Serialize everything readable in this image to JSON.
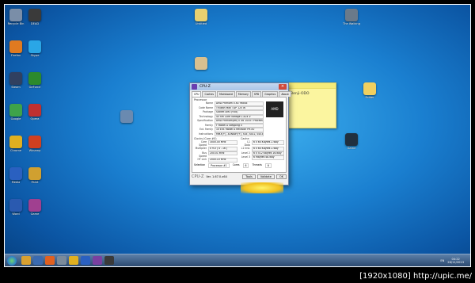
{
  "desktop": {
    "icons": [
      {
        "label": "Recycle Bin",
        "color": "#7a8ea8"
      },
      {
        "label": "DEAD",
        "color": "#3a3a3a"
      },
      {
        "label": "Firefox",
        "color": "#e07a20"
      },
      {
        "label": "Skype",
        "color": "#2aa6e6"
      },
      {
        "label": "Steam",
        "color": "#304060"
      },
      {
        "label": "GeForce",
        "color": "#2c8a2c"
      },
      {
        "label": "Google",
        "color": "#3ea34a"
      },
      {
        "label": "Opera",
        "color": "#c03030"
      },
      {
        "label": "Chrome",
        "color": "#e0b020"
      },
      {
        "label": "Winamp",
        "color": "#d04020"
      },
      {
        "label": "Media",
        "color": "#2a60c0"
      },
      {
        "label": "Paint",
        "color": "#d0a030"
      },
      {
        "label": "Word",
        "color": "#2a5ab0"
      },
      {
        "label": "Game",
        "color": "#a04090"
      }
    ],
    "file_icons": [
      {
        "label": "Untitled",
        "color": "#e8d070"
      },
      {
        "label": "The Walking Dead",
        "color": "#6a7a8a"
      },
      {
        "label": "Folder",
        "color": "#f0d060"
      },
      {
        "label": "Game",
        "color": "#203040"
      }
    ]
  },
  "sticky_note": {
    "text": "Benji-ODO"
  },
  "cpuz": {
    "title": "CPU-Z",
    "tabs": [
      "CPU",
      "Caches",
      "Mainboard",
      "Memory",
      "SPD",
      "Graphics",
      "About"
    ],
    "processor_group": "Processor",
    "rows": [
      {
        "k": "Name",
        "v": "AMD Phenom II X4 965BE"
      },
      {
        "k": "Code Name",
        "v": "Thuban   Max TDP  125 W"
      },
      {
        "k": "Package",
        "v": "Socket AM3 (938)"
      },
      {
        "k": "Technology",
        "v": "45 nm   Core Voltage  1.424 V"
      },
      {
        "k": "Specification",
        "v": "AMD Phenom(tm) II X6 1055T Processor"
      },
      {
        "k": "Family",
        "v": "F    Model  A    Stepping  0"
      },
      {
        "k": "Ext. Family",
        "v": "10   Ext. Model  A   Revision  PH-E0"
      },
      {
        "k": "Instructions",
        "v": "MMX(+), 3DNow!(+), SSE, SSE2, SSE3, SSE4A, x86-64, AMD-V"
      }
    ],
    "clocks_group": "Clocks (Core #0)",
    "cache_group": "Cache",
    "clock_rows": [
      {
        "k": "Core Speed",
        "v": "3000.00 MHz"
      },
      {
        "k": "Multiplier",
        "v": "x 9.0 ( 4 - 16 )"
      },
      {
        "k": "Bus Speed",
        "v": "200.01 MHz"
      },
      {
        "k": "HT Link",
        "v": "2000.10 MHz"
      }
    ],
    "cache_rows": [
      {
        "k": "L1 Data",
        "v": "6 x 64 KBytes  2-way"
      },
      {
        "k": "L1 Inst.",
        "v": "6 x 64 KBytes  2-way"
      },
      {
        "k": "Level 2",
        "v": "6 x 512 KBytes  16-way"
      },
      {
        "k": "Level 3",
        "v": "6 MBytes  48-way"
      }
    ],
    "selection_label": "Selection",
    "selection_value": "Processor #1",
    "cores_label": "Cores",
    "cores_value": "6",
    "threads_label": "Threads",
    "threads_value": "6",
    "brand": "CPU-Z",
    "version": "Ver. 1.67.0.x64",
    "tools_label": "Tools",
    "validate_label": "Validate",
    "ok_label": "OK"
  },
  "taskbar": {
    "apps": [
      {
        "color": "#d8a030"
      },
      {
        "color": "#3a6ab0"
      },
      {
        "color": "#e06020"
      },
      {
        "color": "#7a8a9a"
      },
      {
        "color": "#e0b020"
      },
      {
        "color": "#2a60c0"
      },
      {
        "color": "#7a40a0"
      },
      {
        "color": "#3a3a3a"
      }
    ],
    "language": "EN",
    "time": "04:22",
    "date": "26/11/2013"
  },
  "banner": "[1920x1080] http://upic.me/"
}
